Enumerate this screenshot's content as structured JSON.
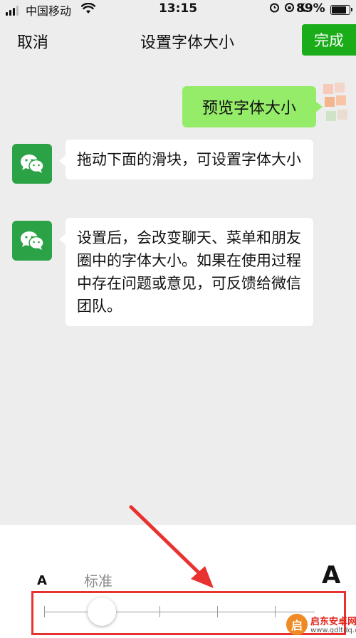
{
  "status_bar": {
    "carrier": "中国移动",
    "time": "13:15",
    "battery": "89%",
    "battery_level": 0.89,
    "icons": [
      "signal-icon",
      "wifi-icon",
      "alarm-icon",
      "orientation-lock-icon",
      "moon-icon",
      "battery-icon"
    ]
  },
  "nav": {
    "cancel_label": "取消",
    "title": "设置字体大小",
    "done_label": "完成"
  },
  "preview": {
    "text": "预览字体大小"
  },
  "messages": [
    {
      "text": "拖动下面的滑块，可设置字体大小"
    },
    {
      "text": "设置后，会改变聊天、菜单和朋友圈中的字体大小。如果在使用过程中存在问题或意见，可反馈给微信团队。"
    }
  ],
  "font_slider": {
    "small_label": "A",
    "standard_label": "标准",
    "large_label": "A",
    "steps": 5,
    "selected_step": 1
  },
  "watermark": {
    "logo_text": "启",
    "title": "启东安卓网",
    "url": "www.qdltdq.com"
  },
  "colors": {
    "accent": "#1aad19",
    "bubble_self": "#95ec69",
    "annotation": "#e8322f",
    "background": "#ededed"
  }
}
